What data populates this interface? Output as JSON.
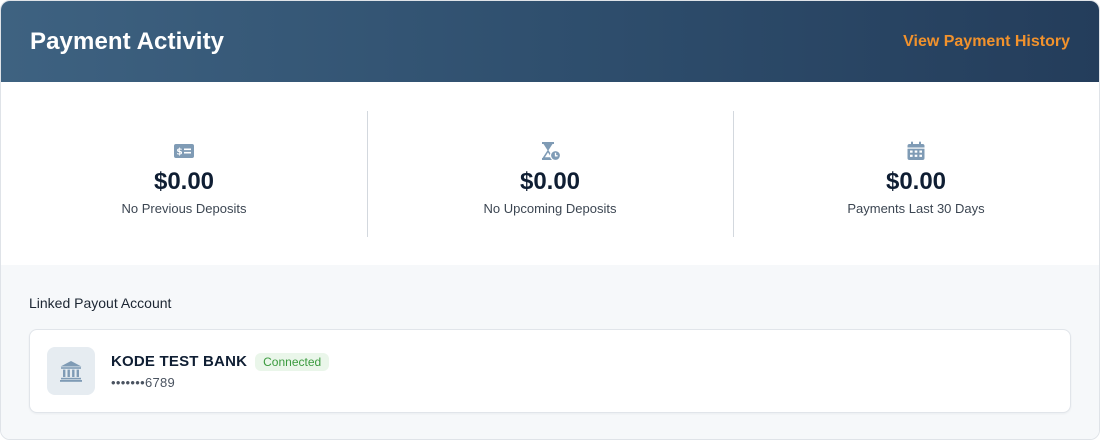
{
  "header": {
    "title": "Payment Activity",
    "link_label": "View Payment History"
  },
  "stats": [
    {
      "icon": "dollar-card-icon",
      "value": "$0.00",
      "label": "No Previous Deposits"
    },
    {
      "icon": "hourglass-clock-icon",
      "value": "$0.00",
      "label": "No Upcoming Deposits"
    },
    {
      "icon": "calendar-icon",
      "value": "$0.00",
      "label": "Payments Last 30 Days"
    }
  ],
  "payout": {
    "title": "Linked Payout Account",
    "account": {
      "icon": "bank-icon",
      "bank_name": "KODE TEST BANK",
      "status": "Connected",
      "masked_number": "•••••••6789"
    }
  },
  "colors": {
    "header_start": "#3e6281",
    "header_end": "#243d5b",
    "accent": "#f2922c",
    "icon": "#7f9bb5",
    "status_green": "#3a9a3e"
  }
}
